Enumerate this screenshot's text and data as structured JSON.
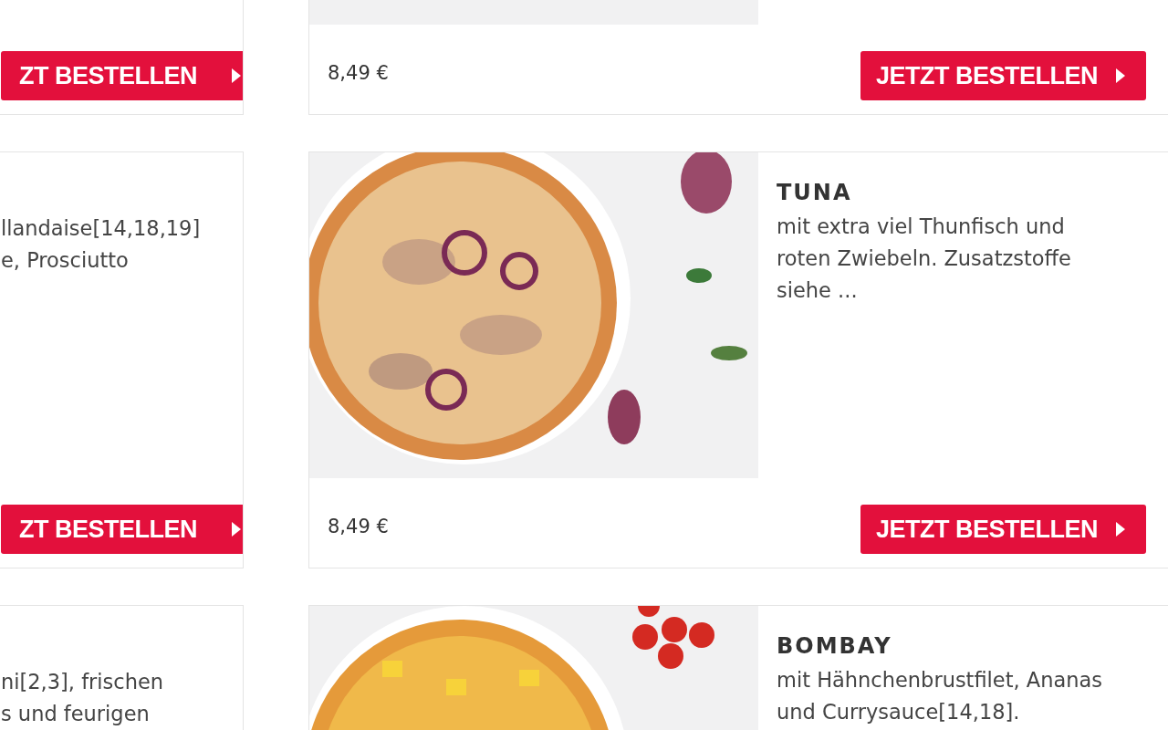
{
  "left_cards": [
    {
      "button": "ZT BESTELLEN"
    },
    {
      "description": "llandaise[14,18,19]\ne, Prosciutto",
      "button": "ZT BESTELLEN"
    },
    {
      "description": "ni[2,3], frischen\ns und feurigen"
    }
  ],
  "right_cards": [
    {
      "price": "8,49 €",
      "button": "JETZT BESTELLEN"
    },
    {
      "title": "TUNA",
      "description": "mit extra viel Thunfisch und\nroten Zwiebeln. Zusatzstoffe\nsiehe ...",
      "price": "8,49 €",
      "button": "JETZT BESTELLEN"
    },
    {
      "title": "BOMBAY",
      "description": "mit Hähnchenbrustfilet, Ananas\nund Currysauce[14,18]."
    }
  ]
}
